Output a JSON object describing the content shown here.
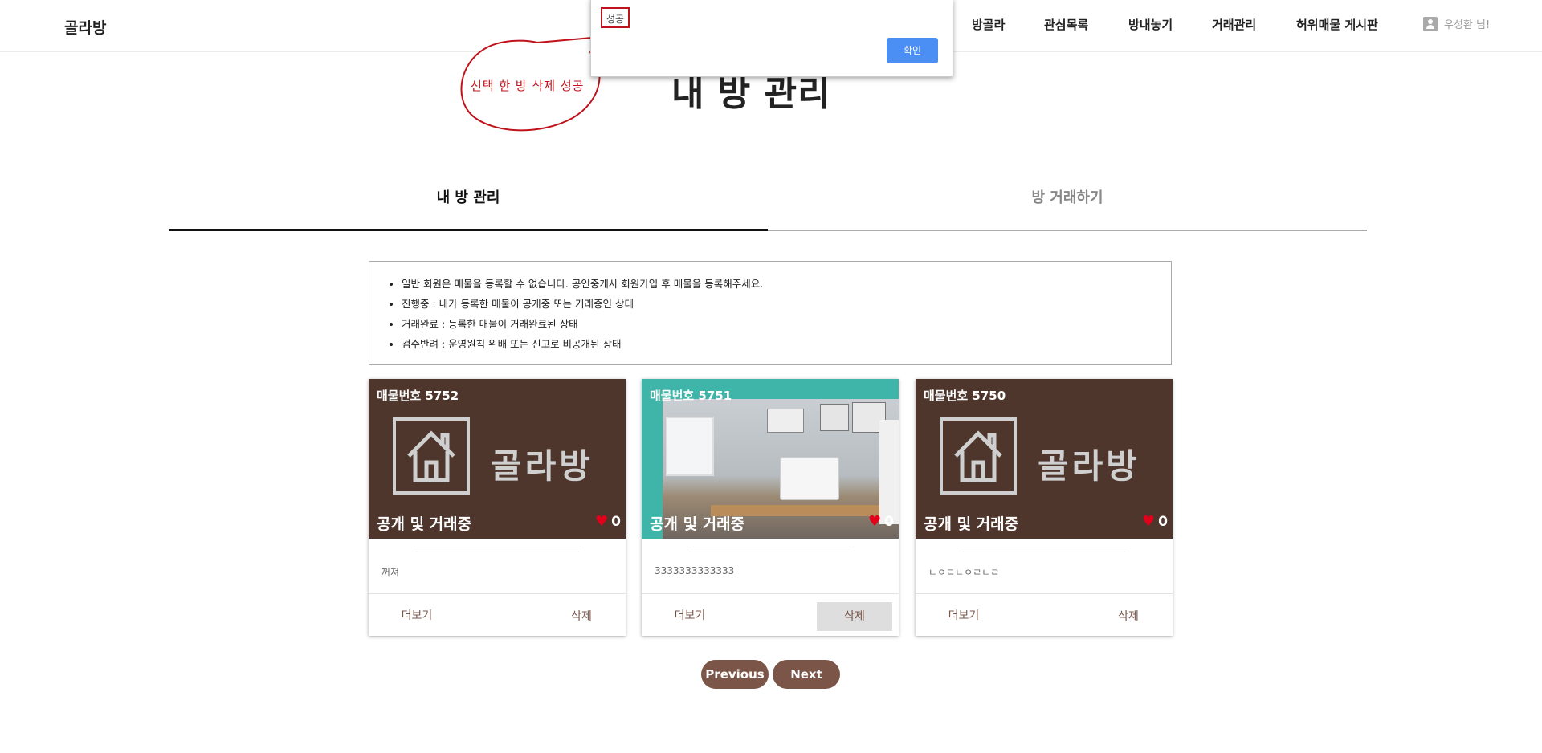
{
  "header": {
    "logo": "골라방",
    "nav": [
      "방골라",
      "관심목록",
      "방내놓기",
      "거래관리",
      "허위매물 게시판"
    ],
    "user": "우성환 님!"
  },
  "page": {
    "title": "내 방 관리"
  },
  "tabs": [
    {
      "label": "내 방 관리",
      "active": true
    },
    {
      "label": "방 거래하기",
      "active": false
    }
  ],
  "info": [
    "일반 회원은 매물을 등록할 수 없습니다. 공인중개사 회원가입 후 매물을 등록해주세요.",
    "진행중 : 내가 등록한 매물이 공개중 또는 거래중인 상태",
    "거래완료 : 등록한 매물이 거래완료된 상태",
    "검수반려 : 운영원칙 위배 또는 신고로 비공개된 상태"
  ],
  "cards": [
    {
      "listing": "매물번호 5752",
      "status": "공개 및 거래중",
      "likes": "0",
      "brand": "골라방",
      "desc": "꺼져",
      "more": "더보기",
      "delete": "삭제"
    },
    {
      "listing": "매물번호 5751",
      "status": "공개 및 거래중",
      "likes": "0",
      "desc": "3333333333333",
      "more": "더보기",
      "delete": "삭제"
    },
    {
      "listing": "매물번호 5750",
      "status": "공개 및 거래중",
      "likes": "0",
      "brand": "골라방",
      "desc": "ㄴㅇㄹㄴㅇㄹㄴㄹ",
      "more": "더보기",
      "delete": "삭제"
    }
  ],
  "pagination": {
    "prev": "Previous",
    "next": "Next"
  },
  "alert": {
    "message": "성공",
    "ok": "확인"
  },
  "annotation": {
    "text": "선택 한 방 삭제 성공"
  },
  "colors": {
    "brand_brown": "#4e362d",
    "button_brown": "#7a5548",
    "accent_red": "#c0121b",
    "ok_blue": "#4b8ff5",
    "teal": "#3fb4a8"
  }
}
